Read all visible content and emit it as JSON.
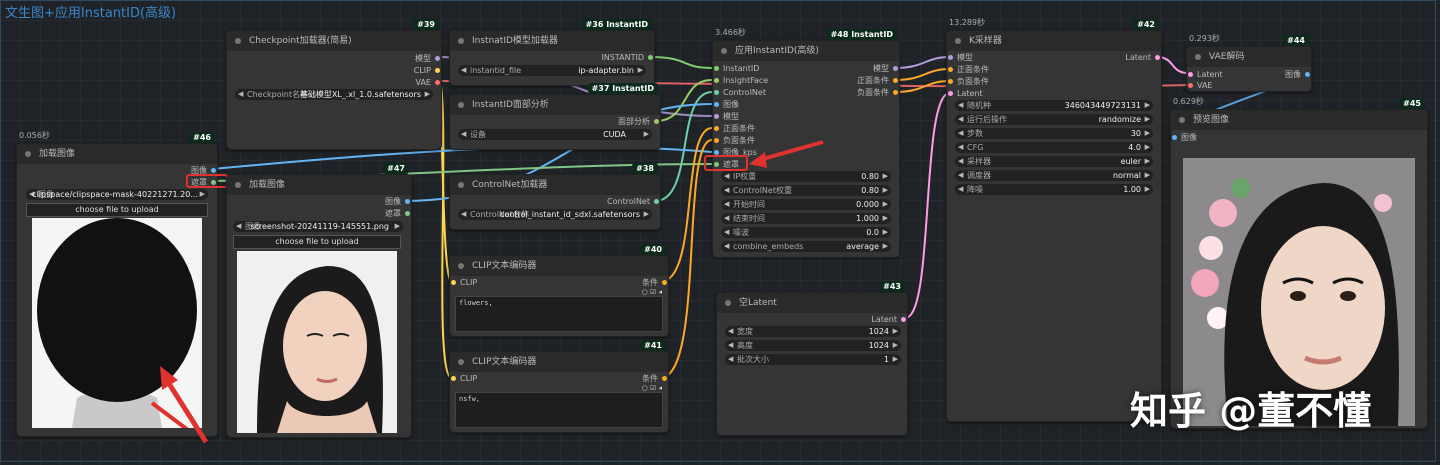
{
  "group": {
    "title": "文生图+应用InstantID(高级)"
  },
  "colors": {
    "model": "#b39ddb",
    "clip": "#ffd54f",
    "vae": "#ff6e6e",
    "image": "#64b5f6",
    "mask": "#81c784",
    "cond": "#ffa726",
    "latent": "#ff9ce6",
    "instantid": "#7ed06f",
    "controlnet": "#6ed0a8",
    "faceanalysis": "#9ccc65"
  },
  "n46": {
    "id": "#46",
    "time": "0.056秒",
    "title": "加载图像",
    "out_image": "图像",
    "out_mask": "遮罩",
    "widget_label": "图像",
    "widget_value": "clipspace/clipspace-mask-40221271.20...",
    "upload": "choose file to upload"
  },
  "n39": {
    "id": "#39",
    "title": "Checkpoint加载器(简易)",
    "out_model": "模型",
    "out_clip": "CLIP",
    "out_vae": "VAE",
    "widget_label": "Checkpoint名称",
    "widget_value": "基础模型XL_.xl_1.0.safetensors"
  },
  "n47": {
    "id": "#47",
    "title": "加载图像",
    "out_image": "图像",
    "out_mask": "遮罩",
    "widget_label": "图像",
    "widget_value": "screenshot-20241119-145551.png",
    "upload": "choose file to upload"
  },
  "n36": {
    "id": "#36 InstantID",
    "title": "InstnatID模型加载器",
    "out": "INSTANTID",
    "widget_label": "instantid_file",
    "widget_value": "ip-adapter.bin"
  },
  "n37": {
    "id": "#37 InstantID",
    "title": "InstantID面部分析",
    "out": "面部分析",
    "widget_label": "设备",
    "widget_value": "CUDA"
  },
  "n38": {
    "id": "#38",
    "title": "ControlNet加载器",
    "out": "ControlNet",
    "widget_label": "ControlNet名称",
    "widget_value": "control_instant_id_sdxl.safetensors"
  },
  "n40": {
    "id": "#40",
    "title": "CLIP文本编码器",
    "in": "CLIP",
    "out": "条件",
    "text": "flowers,"
  },
  "n41": {
    "id": "#41",
    "title": "CLIP文本编码器",
    "in": "CLIP",
    "out": "条件",
    "text": "nsfw,"
  },
  "n48": {
    "id": "#48 InstantID",
    "time": "3.466秒",
    "title": "应用InstantID(高级)",
    "inputs": [
      "InstantID",
      "InsightFace",
      "ControlNet",
      "图像",
      "模型",
      "正面条件",
      "负面条件",
      "图像_kps",
      "遮罩"
    ],
    "outputs": [
      "模型",
      "正面条件",
      "负面条件"
    ],
    "widgets": [
      {
        "label": "IP权重",
        "value": "0.80"
      },
      {
        "label": "ControlNet权重",
        "value": "0.80"
      },
      {
        "label": "开始时间",
        "value": "0.000"
      },
      {
        "label": "结束时间",
        "value": "1.000"
      },
      {
        "label": "噪波",
        "value": "0.0"
      },
      {
        "label": "combine_embeds",
        "value": "average"
      }
    ]
  },
  "n43": {
    "id": "#43",
    "title": "空Latent",
    "out": "Latent",
    "widgets": [
      {
        "label": "宽度",
        "value": "1024"
      },
      {
        "label": "高度",
        "value": "1024"
      },
      {
        "label": "批次大小",
        "value": "1"
      }
    ]
  },
  "n42": {
    "id": "#42",
    "time": "13.289秒",
    "title": "K采样器",
    "inputs": [
      "模型",
      "正面条件",
      "负面条件",
      "Latent"
    ],
    "out": "Latent",
    "widgets": [
      {
        "label": "随机种",
        "value": "346043449723131"
      },
      {
        "label": "运行后操作",
        "value": "randomize"
      },
      {
        "label": "步数",
        "value": "30"
      },
      {
        "label": "CFG",
        "value": "4.0"
      },
      {
        "label": "采样器",
        "value": "euler"
      },
      {
        "label": "调度器",
        "value": "normal"
      },
      {
        "label": "降噪",
        "value": "1.00"
      }
    ]
  },
  "n44": {
    "id": "#44",
    "time": "0.293秒",
    "title": "VAE解码",
    "in_latent": "Latent",
    "in_vae": "VAE",
    "out": "图像"
  },
  "n45": {
    "id": "#45",
    "time": "0.629秒",
    "title": "预览图像",
    "in": "图像"
  },
  "watermark": "知乎 @董不懂"
}
